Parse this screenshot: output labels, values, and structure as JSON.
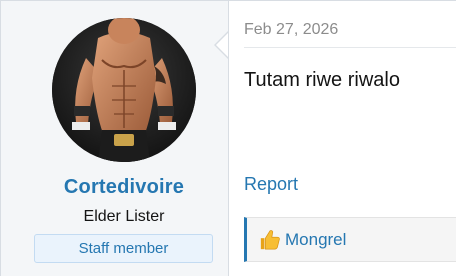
{
  "user": {
    "username": "Cortedivoire",
    "title": "Elder Lister",
    "badge": "Staff member",
    "avatar_icon": "wrestler-avatar"
  },
  "message": {
    "date": "Feb 27, 2026",
    "body": "Tutam riwe riwalo",
    "report_label": "Report"
  },
  "reactions": {
    "icon": "thumbs-up-icon",
    "user": "Mongrel"
  },
  "colors": {
    "accent": "#2577b1",
    "user_cell_bg": "#f4f6f8",
    "badge_bg": "#eaf3fc"
  }
}
